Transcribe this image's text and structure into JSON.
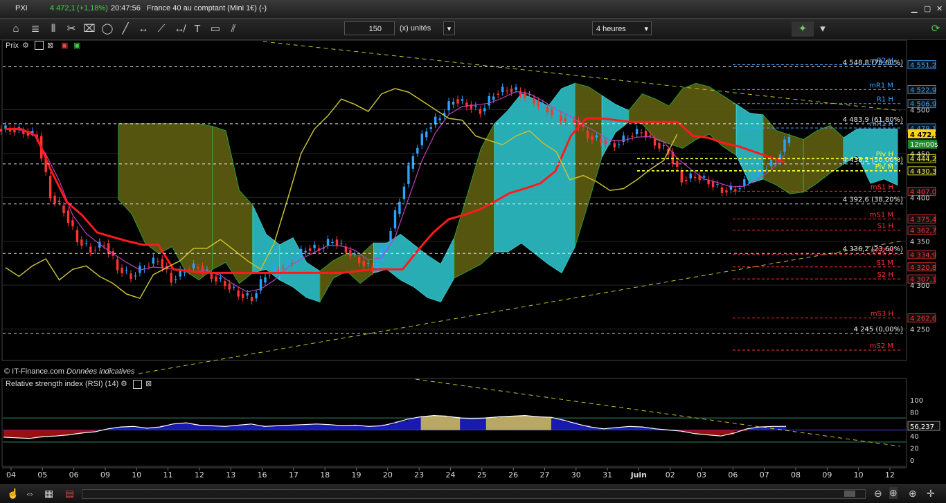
{
  "window": {
    "title": "PXI",
    "last": "4 472,1",
    "change": "(+1,18%)",
    "time": "20:47:56",
    "instrument": "France 40 au comptant (Mini 1€) (-)"
  },
  "toolbar": {
    "period_count": "150",
    "unit_label": "(x) unités",
    "timeframe": "4 heures"
  },
  "price_panel": {
    "label": "Prix",
    "copyright": "© IT-Finance.com",
    "disclaimer": "Données indicatives",
    "countdown": "12m00s"
  },
  "rsi_panel": {
    "label": "Relative strength index (RSI) (14)",
    "value": "56,237",
    "axis_ticks": [
      "100",
      "80",
      "60",
      "40",
      "20",
      "0"
    ]
  },
  "colors": {
    "background": "#000000",
    "bull": "#2aa3ff",
    "bear": "#ff3333",
    "kijun": "#ff1a1a",
    "tenkan": "#c040c0",
    "chikou": "#c8c030",
    "cloud_bull": "#2ab7bd",
    "cloud_bear": "#5a5a10",
    "fib": "#ffffff",
    "pivot": "#ffff33",
    "resistance": "#39a4ff",
    "support": "#ff3333"
  },
  "chart_data": [
    {
      "type": "line",
      "title": "",
      "ylim": [
        4215,
        4565
      ],
      "y_ticks": [
        "4 500",
        "4 450",
        "4 400",
        "4 350",
        "4 300",
        "4 250"
      ],
      "x_ticks": [
        "04",
        "05",
        "06",
        "09",
        "10",
        "11",
        "12",
        "13",
        "16",
        "17",
        "18",
        "19",
        "20",
        "23",
        "24",
        "25",
        "26",
        "27",
        "30",
        "31",
        "juin",
        "02",
        "03",
        "06",
        "07",
        "08",
        "09",
        "10",
        "12"
      ],
      "last_price": 4472.1,
      "levels": [
        {
          "label": "4 548,8 (78,60%)",
          "value": 4548.8,
          "kind": "fib"
        },
        {
          "label": "4 483,9 (61,80%)",
          "value": 4483.9,
          "kind": "fib"
        },
        {
          "label": "4 438,2 (50,00%)",
          "value": 4438.2,
          "kind": "fib"
        },
        {
          "label": "4 392,6 (38,20%)",
          "value": 4392.6,
          "kind": "fib"
        },
        {
          "label": "4 336,2 (23,60%)",
          "value": 4336.2,
          "kind": "fib"
        },
        {
          "label": "4 245 (0,00%)",
          "value": 4245.0,
          "kind": "fib"
        }
      ],
      "markers": [
        {
          "name": "mR2 H",
          "price": "4 551,2",
          "value": 4551.2,
          "kind": "resistance"
        },
        {
          "name": "mR1 M",
          "price": "4 522,9",
          "value": 4522.9,
          "kind": "resistance"
        },
        {
          "name": "R1 H",
          "price": "4 506,9",
          "value": 4506.9,
          "kind": "resistance"
        },
        {
          "name": "mR1 H",
          "price": "4 479,1",
          "value": 4479.1,
          "kind": "resistance"
        },
        {
          "name": "Piv H",
          "price": "4 444,2",
          "value": 4444.2,
          "kind": "pivot"
        },
        {
          "name": "Piv M",
          "price": "4 430,3",
          "value": 4430.3,
          "kind": "pivot"
        },
        {
          "name": "mS1 H",
          "price": "4 407,0",
          "value": 4407.0,
          "kind": "support"
        },
        {
          "name": "mS1 M",
          "price": "4 375,4",
          "value": 4375.4,
          "kind": "support"
        },
        {
          "name": "S1 H",
          "price": "4 362,7",
          "value": 4362.7,
          "kind": "support"
        },
        {
          "name": "mS2 H",
          "price": "4 334,9",
          "value": 4334.9,
          "kind": "support"
        },
        {
          "name": "S1 M",
          "price": "4 320,8",
          "value": 4320.8,
          "kind": "support"
        },
        {
          "name": "S2 H",
          "price": "4 307,1",
          "value": 4307.1,
          "kind": "support"
        },
        {
          "name": "mS3 H",
          "price": "4 262,6",
          "value": 4262.6,
          "kind": "support"
        },
        {
          "name": "mS2 M",
          "price": "",
          "value": 4226.0,
          "kind": "support"
        }
      ],
      "series": [
        {
          "key": "close",
          "values": [
            4478,
            4475,
            4470,
            4402,
            4385,
            4352,
            4340,
            4348,
            4320,
            4310,
            4322,
            4330,
            4306,
            4318,
            4322,
            4310,
            4302,
            4290,
            4285,
            4312,
            4320,
            4328,
            4342,
            4342,
            4352,
            4340,
            4328,
            4318,
            4348,
            4398,
            4450,
            4478,
            4493,
            4512,
            4506,
            4498,
            4518,
            4524,
            4520,
            4510,
            4500,
            4490,
            4488,
            4470,
            4465,
            4460,
            4470,
            4476,
            4462,
            4452,
            4420,
            4425,
            4418,
            4408,
            4410,
            4420,
            4432,
            4442,
            4472
          ]
        },
        {
          "key": "kijun",
          "values": [
            4478,
            4478,
            4470,
            4430,
            4395,
            4380,
            4360,
            4355,
            4350,
            4346,
            4346,
            4318,
            4316,
            4314,
            4314,
            4314,
            4314,
            4314,
            4314,
            4314,
            4314,
            4314,
            4314,
            4316,
            4318,
            4318,
            4318,
            4340,
            4360,
            4375,
            4380,
            4386,
            4395,
            4405,
            4410,
            4416,
            4430,
            4470,
            4490,
            4490,
            4488,
            4486,
            4486,
            4486,
            4486,
            4470,
            4468,
            4462,
            4458,
            4452,
            4446,
            4440
          ]
        }
      ]
    },
    {
      "type": "line",
      "title": "",
      "ylim": [
        0,
        100
      ],
      "series": [
        {
          "key": "rsi",
          "values": [
            38,
            37,
            36,
            39,
            40,
            42,
            45,
            47,
            52,
            55,
            56,
            53,
            55,
            60,
            62,
            58,
            57,
            56,
            58,
            60,
            56,
            57,
            58,
            59,
            60,
            59,
            57,
            58,
            56,
            57,
            62,
            68,
            72,
            74,
            73,
            70,
            69,
            70,
            72,
            73,
            74,
            72,
            71,
            66,
            60,
            55,
            52,
            54,
            56,
            55,
            52,
            50,
            48,
            44,
            42,
            40,
            45,
            52,
            55,
            56,
            56
          ]
        }
      ]
    }
  ]
}
